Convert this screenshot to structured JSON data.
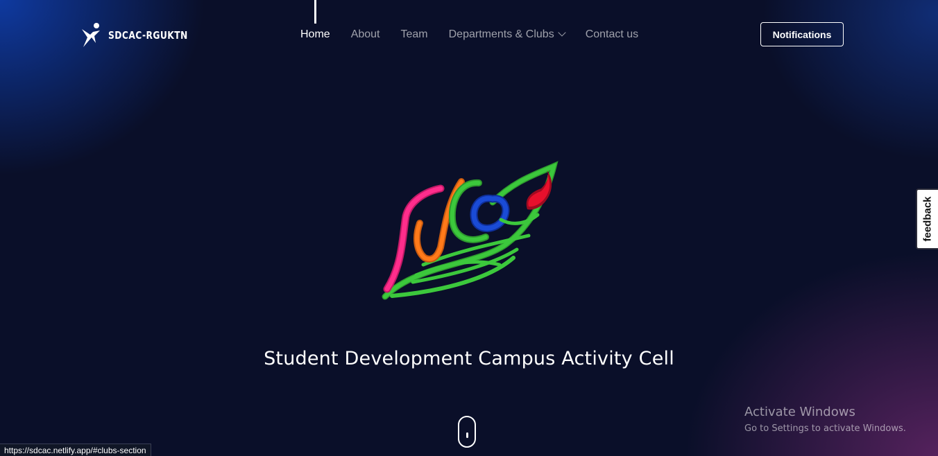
{
  "brand": {
    "name": "SDCAC-RGUKTN",
    "logo_icon": "person-star-icon"
  },
  "nav": {
    "items": [
      {
        "label": "Home",
        "active": true
      },
      {
        "label": "About",
        "active": false
      },
      {
        "label": "Team",
        "active": false
      },
      {
        "label": "Departments & Clubs",
        "active": false,
        "dropdown": true
      },
      {
        "label": "Contact us",
        "active": false
      }
    ],
    "dropdown_icon": "chevron-down-icon"
  },
  "header": {
    "notifications_label": "Notifications"
  },
  "hero": {
    "logo_icon": "sdcac-feather-logo",
    "title": "Student Development Campus Activity Cell",
    "scroll_icon": "mouse-scroll-icon"
  },
  "feedback": {
    "label": "feedback"
  },
  "watermark": {
    "title": "Activate Windows",
    "subtitle": "Go to Settings to activate Windows."
  },
  "status_bar": {
    "url": "https://sdcac.netlify.app/#clubs-section"
  },
  "colors": {
    "background": "#0a0f29",
    "accent_blue": "#1048c8",
    "accent_purple": "#6e286e",
    "logo_pink": "#ff2d8c",
    "logo_orange": "#ff7a1a",
    "logo_green": "#3cc83c",
    "logo_blue": "#1a4bd6",
    "logo_red": "#e8102c"
  }
}
